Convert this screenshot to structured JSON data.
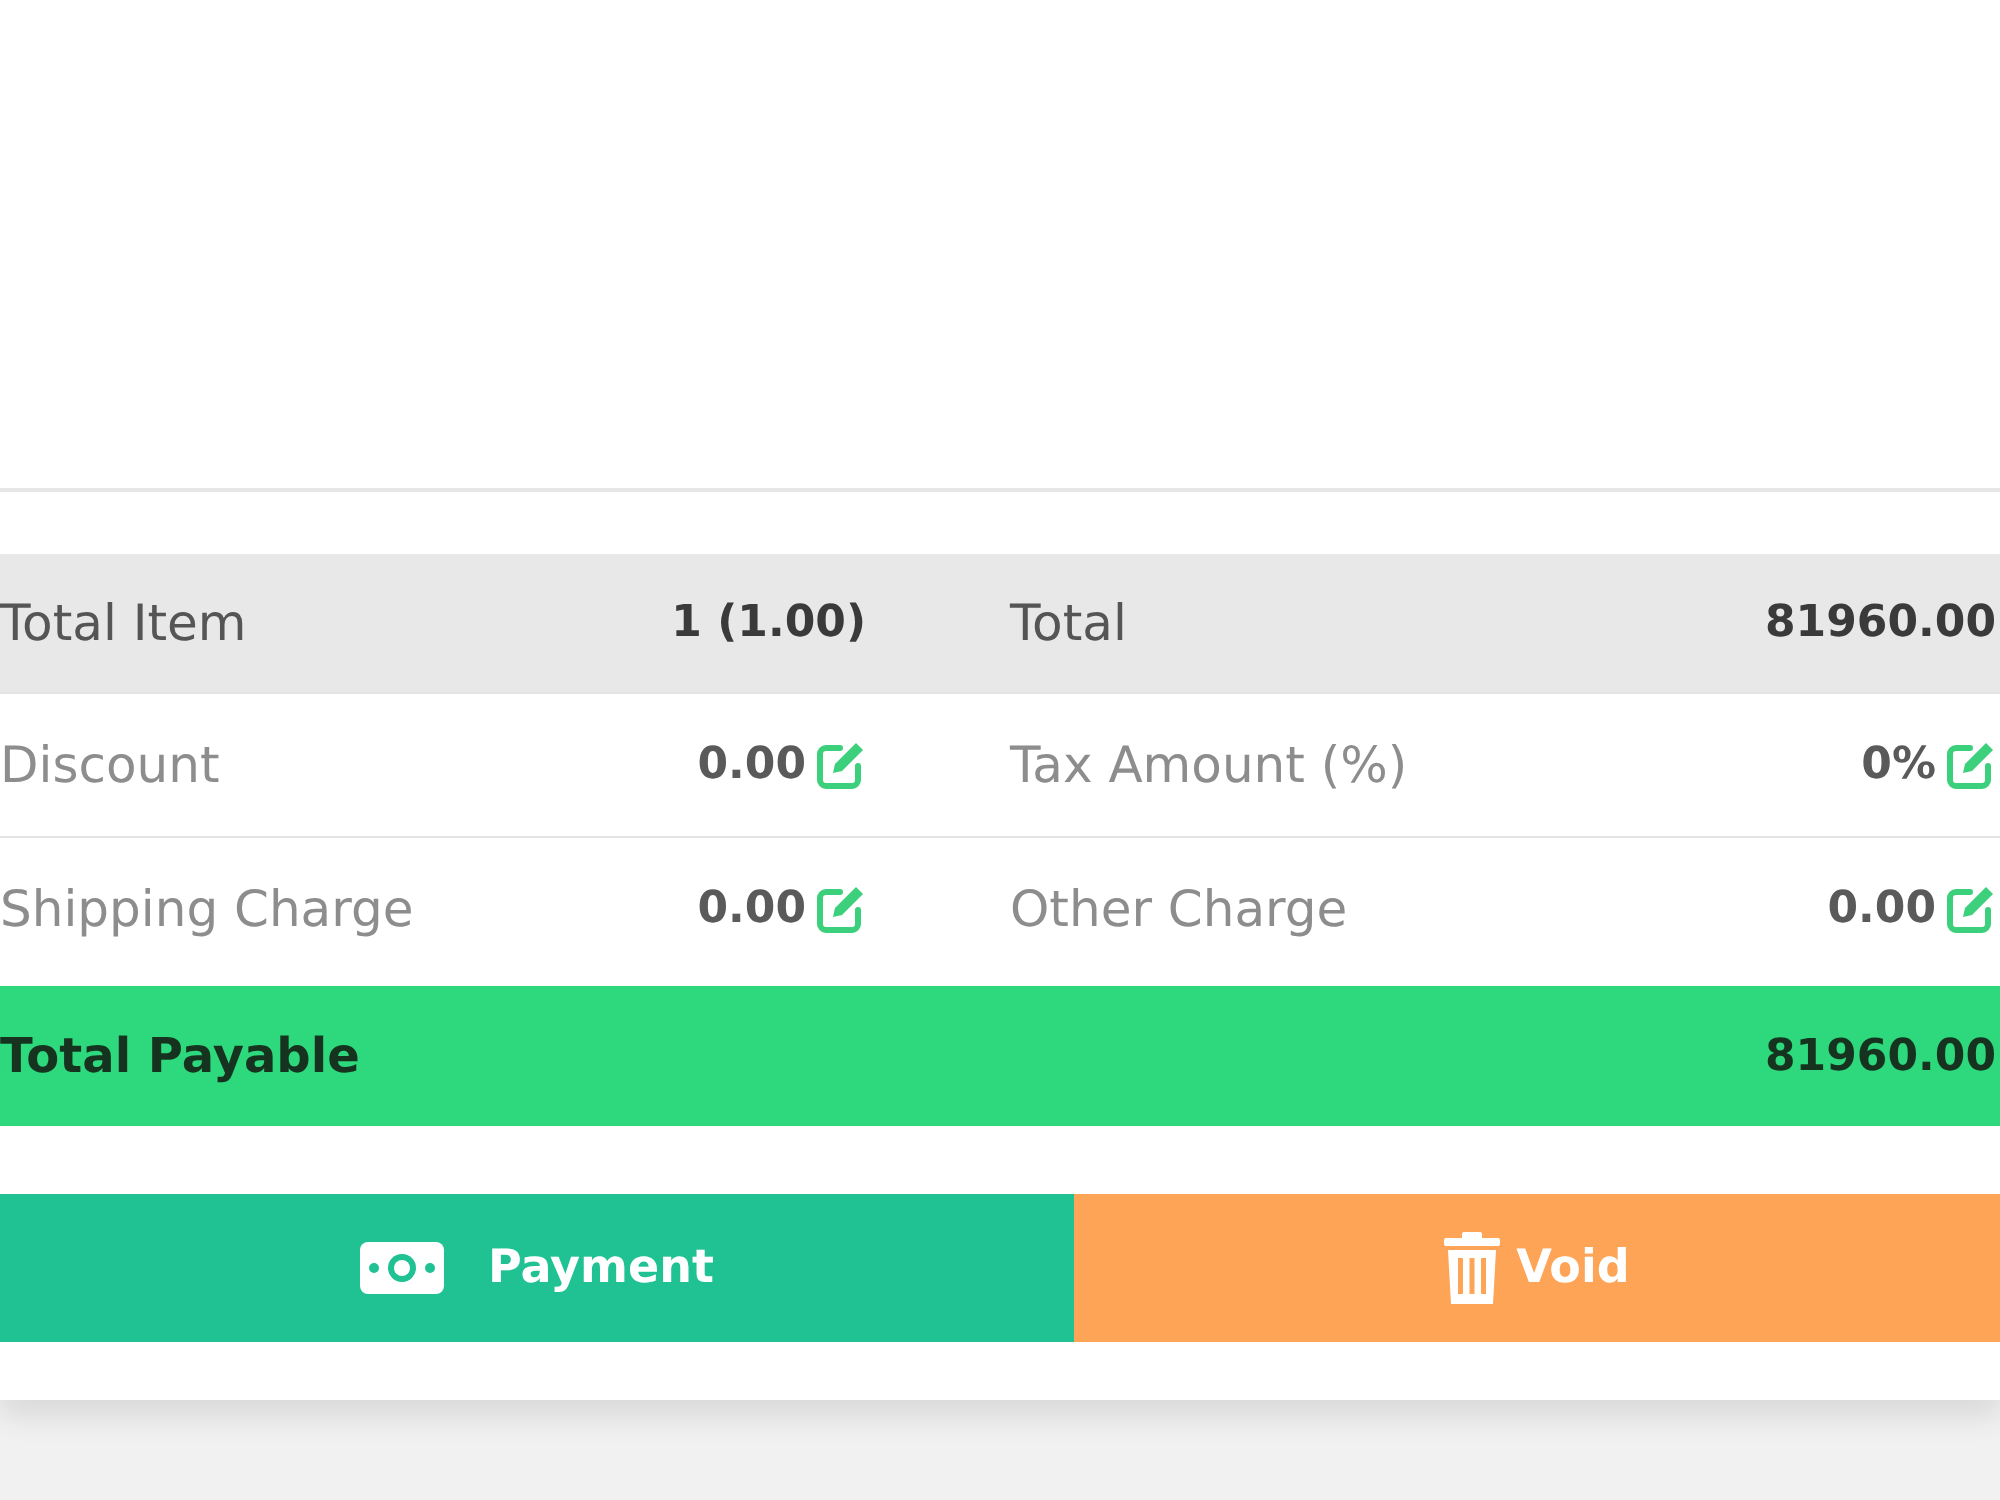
{
  "summary_rows": [
    {
      "kind": "shaded",
      "cells": [
        {
          "label": "Total Item",
          "value": "1 (1.00)",
          "editable": false
        },
        {
          "label": "Total",
          "value": "81960.00",
          "editable": false
        }
      ]
    },
    {
      "kind": "plain",
      "cells": [
        {
          "label": "Discount",
          "value": "0.00",
          "editable": true
        },
        {
          "label": "Tax Amount (%)",
          "value": "0%",
          "editable": true
        }
      ]
    },
    {
      "kind": "plain",
      "cells": [
        {
          "label": "Shipping Charge",
          "value": "0.00",
          "editable": true
        },
        {
          "label": "Other Charge",
          "value": "0.00",
          "editable": true
        }
      ]
    }
  ],
  "total_payable": {
    "label": "Total Payable",
    "value": "81960.00"
  },
  "buttons": [
    {
      "kind": "payment",
      "label": "Payment"
    },
    {
      "kind": "void",
      "label": "Void"
    }
  ]
}
